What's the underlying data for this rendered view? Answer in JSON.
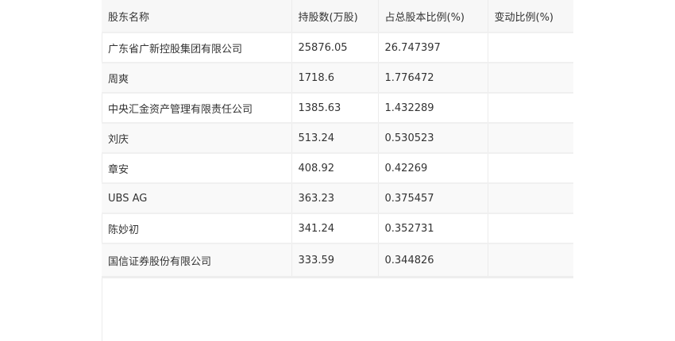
{
  "table": {
    "headers": [
      "股东名称",
      "持股数(万股)",
      "占总股本比例(%)",
      "变动比例(%)"
    ],
    "rows": [
      {
        "name": "广东省广新控股集团有限公司",
        "shares": "25876.05",
        "ratio": "26.747397",
        "change": ""
      },
      {
        "name": "周爽",
        "shares": "1718.6",
        "ratio": "1.776472",
        "change": ""
      },
      {
        "name": "中央汇金资产管理有限责任公司",
        "shares": "1385.63",
        "ratio": "1.432289",
        "change": ""
      },
      {
        "name": "刘庆",
        "shares": "513.24",
        "ratio": "0.530523",
        "change": ""
      },
      {
        "name": "章安",
        "shares": "408.92",
        "ratio": "0.42269",
        "change": ""
      },
      {
        "name": "UBS AG",
        "shares": "363.23",
        "ratio": "0.375457",
        "change": ""
      },
      {
        "name": "陈妙初",
        "shares": "341.24",
        "ratio": "0.352731",
        "change": ""
      },
      {
        "name": "国信证券股份有限公司",
        "shares": "333.59",
        "ratio": "0.344826",
        "change": ""
      }
    ]
  }
}
